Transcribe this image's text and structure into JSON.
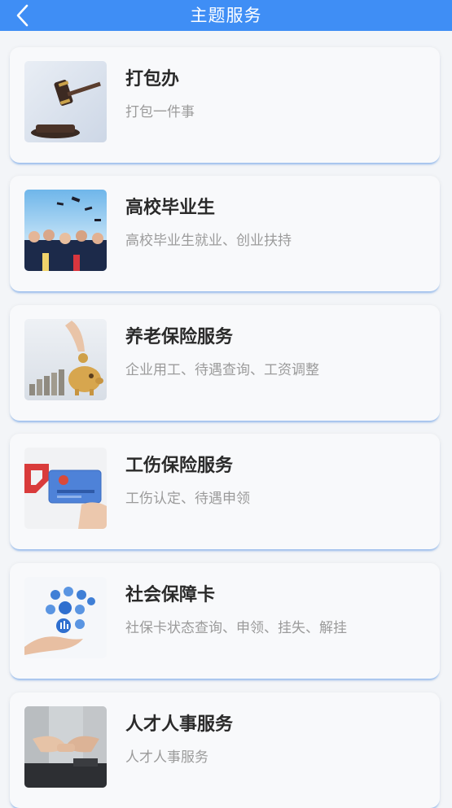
{
  "header": {
    "title": "主题服务",
    "back_icon": "chevron-left-icon",
    "bg_color": "#3f8ef5"
  },
  "services": [
    {
      "title": "打包办",
      "subtitle": "打包一件事",
      "image": "gavel-image"
    },
    {
      "title": "高校毕业生",
      "subtitle": "高校毕业生就业、创业扶持",
      "image": "graduation-caps-image"
    },
    {
      "title": "养老保险服务",
      "subtitle": "企业用工、待遇查询、工资调整",
      "image": "piggy-bank-coins-image"
    },
    {
      "title": "工伤保险服务",
      "subtitle": "工伤认定、待遇申领",
      "image": "social-security-card-image"
    },
    {
      "title": "社会保障卡",
      "subtitle": "社保卡状态查询、申领、挂失、解挂",
      "image": "hand-with-icons-image"
    },
    {
      "title": "人才人事服务",
      "subtitle": "人才人事服务",
      "image": "handshake-people-image"
    }
  ]
}
